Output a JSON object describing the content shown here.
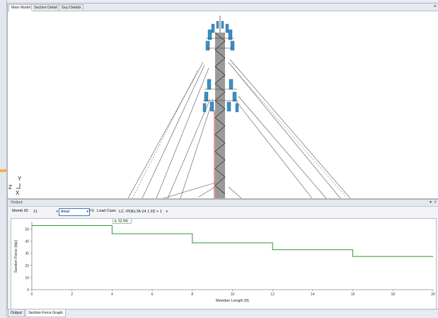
{
  "tabs": [
    {
      "label": "Main Model"
    },
    {
      "label": "Section Detail"
    },
    {
      "label": "Guy Details"
    }
  ],
  "close_symbol": "×",
  "axes_indicator": {
    "y": "Y",
    "z": "Z",
    "x": "X"
  },
  "output": {
    "title": "Output",
    "pin_symbol": "▾",
    "close_symbol": "×",
    "memb_id_label": "Memb ID:",
    "memb_id_value": "11",
    "force_type_value": "Axial",
    "fx_label": "FX",
    "load_case_label": "Load Case:",
    "load_case_value": "LC -PDELTA 24  1.2D + 1"
  },
  "bottom_tabs": [
    {
      "label": "Output"
    },
    {
      "label": "Section Force Graph"
    }
  ],
  "colors": {
    "accent": "#3d7bd2",
    "series": "#2e9a2e",
    "tower": "#c0392b"
  },
  "chart_data": {
    "type": "line",
    "xlabel": "Member Length (ft)",
    "ylabel": "Section Force (kip)",
    "xlim": [
      0,
      20
    ],
    "ylim": [
      0,
      55
    ],
    "xticks": [
      0,
      2,
      4,
      6,
      8,
      10,
      12,
      14,
      16,
      18,
      20
    ],
    "yticks": [
      0,
      10,
      20,
      30,
      40,
      50
    ],
    "grid": false,
    "series": [
      {
        "x": [
          0,
          4,
          4,
          8,
          8,
          12,
          12,
          16,
          16,
          20
        ],
        "values": [
          52.94,
          52.94,
          46.2,
          46.2,
          38.7,
          38.7,
          33.0,
          33.0,
          27.4,
          27.4
        ]
      }
    ],
    "annotation": {
      "text": "4, 52.94)",
      "x": 4,
      "y": 52.94
    }
  }
}
